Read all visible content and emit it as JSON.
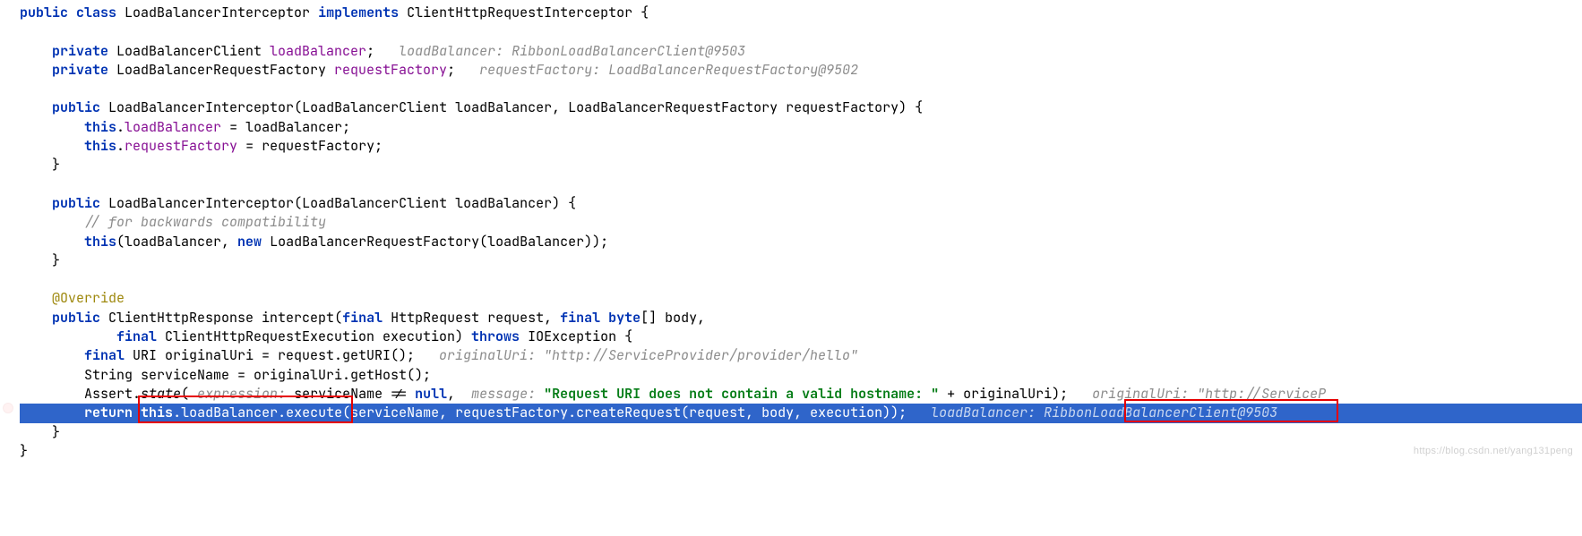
{
  "code": {
    "l1": "public class LoadBalancerInterceptor implements ClientHttpRequestInterceptor {",
    "l2": "",
    "l3": "    private LoadBalancerClient loadBalancer;",
    "l3h": "loadBalancer: RibbonLoadBalancerClient@9503",
    "l4": "    private LoadBalancerRequestFactory requestFactory;",
    "l4h": "requestFactory: LoadBalancerRequestFactory@9502",
    "l5": "",
    "l6": "    public LoadBalancerInterceptor(LoadBalancerClient loadBalancer, LoadBalancerRequestFactory requestFactory) {",
    "l7": "        this.loadBalancer = loadBalancer;",
    "l8": "        this.requestFactory = requestFactory;",
    "l9": "    }",
    "l10": "",
    "l11": "    public LoadBalancerInterceptor(LoadBalancerClient loadBalancer) {",
    "l12": "        // for backwards compatibility",
    "l13": "        this(loadBalancer, new LoadBalancerRequestFactory(loadBalancer));",
    "l14": "    }",
    "l15": "",
    "l16": "    @Override",
    "l17": "    public ClientHttpResponse intercept(final HttpRequest request, final byte[] body,",
    "l18": "            final ClientHttpRequestExecution execution) throws IOException {",
    "l19": "        final URI originalUri = request.getURI();",
    "l19h": "originalUri: \"http://ServiceProvider/provider/hello\"",
    "l20": "        String serviceName = originalUri.getHost();",
    "l21a": "        Assert.",
    "l21b": "state",
    "l21c": "(",
    "l21p": " expression: ",
    "l21d": "serviceName != null,  ",
    "l21m": "message: ",
    "l21s": "\"Request URI does not contain a valid hostname: \"",
    "l21e": " + originalUri);",
    "l21h": "originalUri: \"http://ServiceP",
    "l22a": "        return",
    "l22b": " this.loadBalancer.execute(",
    "l22c": "serviceName, requestFactory.createRequest(request, body, execution));",
    "l22h": "loadBalancer: ",
    "l22h2": "RibbonLoadBalancerClient",
    "l22h3": "@9503  ",
    "l23": "    }",
    "l24": "}"
  },
  "watermark": "https://blog.csdn.net/yang131peng"
}
